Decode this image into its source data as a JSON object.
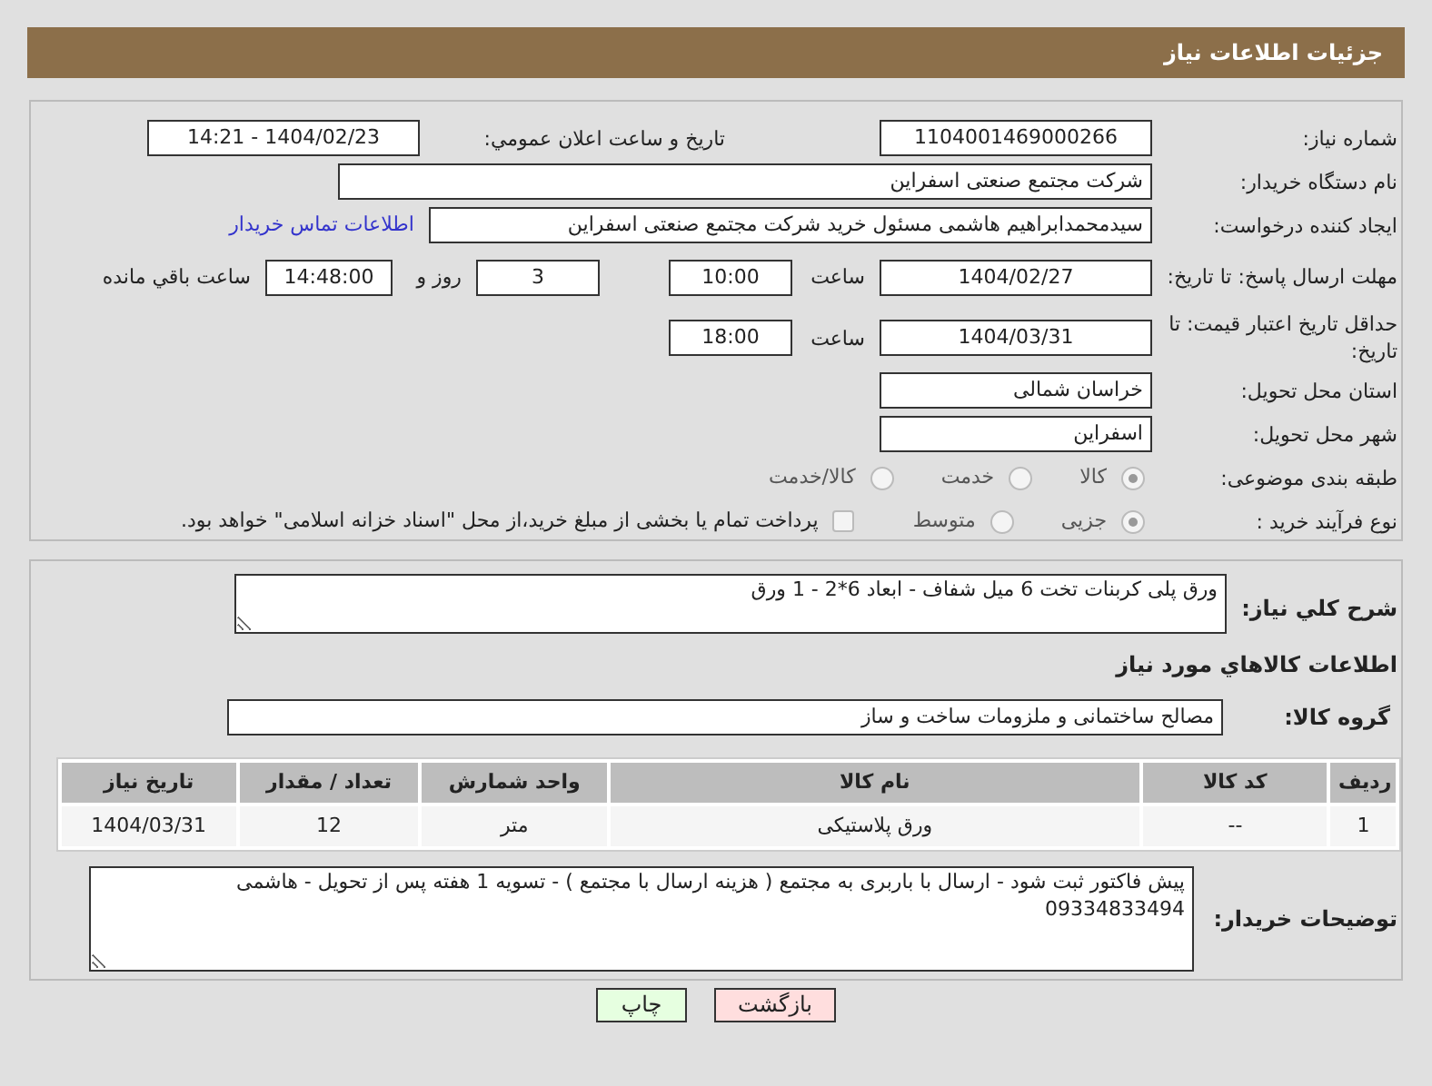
{
  "header": {
    "title": "جزئيات اطلاعات نياز"
  },
  "need_number": {
    "label": "شماره نیاز:",
    "value": "1104001469000266"
  },
  "announce": {
    "label": "تاريخ و ساعت اعلان عمومي:",
    "value": "1404/02/23 - 14:21"
  },
  "buyer_org": {
    "label": "نام دستگاه خریدار:",
    "value": "شرکت مجتمع صنعتی اسفراین"
  },
  "requester": {
    "label": "ایجاد کننده درخواست:",
    "value": "سیدمحمدابراهیم هاشمی مسئول خرید شرکت مجتمع صنعتی اسفراین",
    "link": "اطلاعات تماس خریدار"
  },
  "reply_deadline": {
    "label": "مهلت ارسال پاسخ: تا تاریخ:",
    "date": "1404/02/27",
    "time_label": "ساعت",
    "time": "10:00",
    "days": "3",
    "days_label": "روز و",
    "remaining": "14:48:00",
    "remaining_label": "ساعت باقي مانده"
  },
  "price_validity": {
    "label": "حداقل تاریخ اعتبار قیمت: تا تاریخ:",
    "date": "1404/03/31",
    "time_label": "ساعت",
    "time": "18:00"
  },
  "province": {
    "label": "استان محل تحویل:",
    "value": "خراسان شمالی"
  },
  "city": {
    "label": "شهر محل تحویل:",
    "value": "اسفراین"
  },
  "category": {
    "label": "طبقه بندی موضوعی:",
    "options": [
      {
        "label": "کالا",
        "selected": true
      },
      {
        "label": "خدمت",
        "selected": false
      },
      {
        "label": "کالا/خدمت",
        "selected": false
      }
    ]
  },
  "process": {
    "label": "نوع فرآیند خرید :",
    "options": [
      {
        "label": "جزیی",
        "selected": true
      },
      {
        "label": "متوسط",
        "selected": false
      }
    ],
    "payment": {
      "label": "پرداخت تمام یا بخشی از مبلغ خرید،از محل \"اسناد خزانه اسلامی\" خواهد بود.",
      "checked": false
    }
  },
  "description": {
    "label": "شرح كلي نياز:",
    "value": "ورق پلی کربنات تخت 6 میل شفاف - ابعاد 6*2 - 1 ورق"
  },
  "goods_heading": "اطلاعات كالاهاي مورد نياز",
  "goods_group": {
    "label": "گروه کالا:",
    "value": "مصالح ساختمانی و ملزومات ساخت و ساز"
  },
  "table": {
    "columns": [
      "ردیف",
      "کد کالا",
      "نام کالا",
      "واحد شمارش",
      "تعداد / مقدار",
      "تاریخ نیاز"
    ],
    "rows": [
      [
        "1",
        "--",
        "ورق پلاستیکی",
        "متر",
        "12",
        "1404/03/31"
      ]
    ]
  },
  "buyer_notes": {
    "label": "توضیحات خریدار:",
    "value": "پیش فاکتور ثبت شود - ارسال با باربری به مجتمع ( هزینه ارسال با مجتمع ) - تسویه 1 هفته پس از تحویل - هاشمی 09334833494"
  },
  "buttons": [
    {
      "label": "بازگشت",
      "kind": "back"
    },
    {
      "label": "چاپ",
      "kind": "print"
    }
  ]
}
